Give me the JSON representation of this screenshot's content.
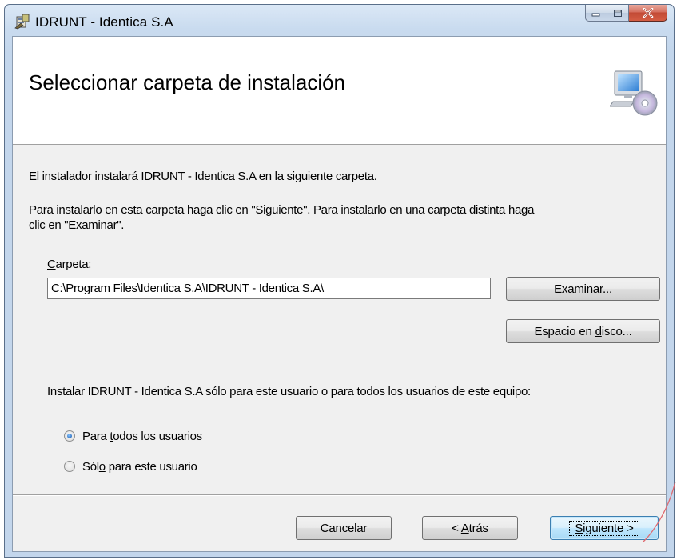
{
  "window": {
    "title": "IDRUNT - Identica S.A"
  },
  "banner": {
    "title": "Seleccionar carpeta de instalación",
    "icon": "computer-cd-icon"
  },
  "body": {
    "intro": "El instalador instalará IDRUNT - Identica S.A en la siguiente carpeta.",
    "instructions_line1": "Para instalarlo en esta carpeta haga clic en \"Siguiente\". Para instalarlo en una carpeta distinta haga",
    "instructions_line2": "clic en \"Examinar\".",
    "folder_label_accel": "C",
    "folder_label_rest": "arpeta:",
    "folder_value": "C:\\Program Files\\Identica S.A\\IDRUNT - Identica S.A\\",
    "browse_accel": "E",
    "browse_rest": "xaminar...",
    "disk_pre": "Espacio en ",
    "disk_accel": "d",
    "disk_post": "isco...",
    "scope_question": "Instalar IDRUNT - Identica S.A sólo para este usuario o para todos los usuarios de este equipo:",
    "radio_all_pre": "Para ",
    "radio_all_accel": "t",
    "radio_all_post": "odos los usuarios",
    "radio_me_pre": "Sól",
    "radio_me_accel": "o",
    "radio_me_post": " para este usuario",
    "selected_scope": "all"
  },
  "footer": {
    "cancel": "Cancelar",
    "back_pre": "< ",
    "back_accel": "A",
    "back_post": "trás",
    "next_accel": "S",
    "next_post": "iguiente >"
  },
  "colors": {
    "titlebar": "#c3d6ec",
    "close_button": "#c24a35",
    "dialog_bg": "#f0f0f0",
    "primary_button": "#bee6fd"
  }
}
